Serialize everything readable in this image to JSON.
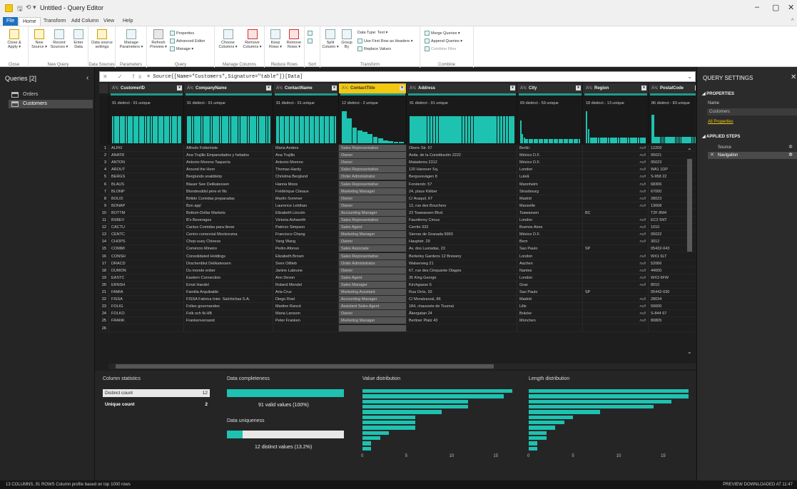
{
  "window": {
    "title": "Untitled - Query Editor",
    "minimize": "–",
    "maximize": "▢",
    "close": "✕",
    "help": "^"
  },
  "menu": {
    "tabs": [
      "File",
      "Home",
      "Transform",
      "Add Column",
      "View",
      "Help"
    ],
    "active": "Home"
  },
  "ribbon": {
    "groups": [
      {
        "label": "Close",
        "buttons": [
          "Close & Apply ▾"
        ]
      },
      {
        "label": "New Query",
        "buttons": [
          "New Source ▾",
          "Recent Sources ▾",
          "Enter Data"
        ]
      },
      {
        "label": "Data Sources",
        "buttons": [
          "Data source settings"
        ]
      },
      {
        "label": "Parameters",
        "buttons": [
          "Manage Parameters ▾"
        ]
      },
      {
        "label": "Query",
        "buttons": [
          "Refresh Preview ▾"
        ],
        "small": [
          "Properties",
          "Advanced Editor",
          "Manage ▾"
        ]
      },
      {
        "label": "Manage Columns",
        "buttons": [
          "Choose Columns ▾",
          "Remove Columns ▾"
        ]
      },
      {
        "label": "Reduce Rows",
        "buttons": [
          "Keep Rows ▾",
          "Remove Rows ▾"
        ]
      },
      {
        "label": "Sort",
        "buttons": []
      },
      {
        "label": "Transform",
        "buttons": [
          "Split Column ▾",
          "Group By"
        ],
        "small": [
          "Data Type: Text ▾",
          "Use First Row as Headers ▾",
          "Replace Values"
        ]
      },
      {
        "label": "Combine",
        "small": [
          "Merge Queries ▾",
          "Append Queries ▾",
          "Combine Files"
        ]
      }
    ]
  },
  "queries": {
    "title": "Queries [2]",
    "items": [
      "Orders",
      "Customers"
    ],
    "selected": "Customers"
  },
  "formula": {
    "fx": "✕ ✓ fx",
    "text": "= Source{[Name=\"Customers\",Signature=\"table\"]}[Data]"
  },
  "columns": [
    {
      "name": "CustomerID",
      "type": "A¹c",
      "distinct": "91 distinct - 91 unique"
    },
    {
      "name": "CompanyName",
      "type": "A¹c",
      "distinct": "91 distinct - 91 unique"
    },
    {
      "name": "ContactName",
      "type": "A¹c",
      "distinct": "91 distinct - 91 unique"
    },
    {
      "name": "ContactTitle",
      "type": "A¹c",
      "distinct": "12 distinct - 2 unique"
    },
    {
      "name": "Address",
      "type": "A¹c",
      "distinct": "91 distinct - 91 unique"
    },
    {
      "name": "City",
      "type": "A¹c",
      "distinct": "69 distinct - 59 unique"
    },
    {
      "name": "Region",
      "type": "A¹c",
      "distinct": "18 distinct - 13 unique"
    },
    {
      "name": "PostalCode",
      "type": "A¹c",
      "distinct": "86 distinct - 83 unique"
    }
  ],
  "rows": [
    [
      "1",
      "ALFKI",
      "Alfreds Futterkiste",
      "Maria Anders",
      "Sales Representative",
      "Obere Str. 57",
      "Berlin",
      "null",
      "12209"
    ],
    [
      "2",
      "ANATR",
      "Ana Trujillo Emparedados y helados",
      "Ana Trujillo",
      "Owner",
      "Avda. de la Constitución 2222",
      "México D.F.",
      "null",
      "05021"
    ],
    [
      "3",
      "ANTON",
      "Antonio Moreno Taquería",
      "Antonio Moreno",
      "Owner",
      "Mataderos  2312",
      "México D.F.",
      "null",
      "05023"
    ],
    [
      "4",
      "AROUT",
      "Around the Horn",
      "Thomas Hardy",
      "Sales Representative",
      "120 Hanover Sq.",
      "London",
      "null",
      "WA1 1DP"
    ],
    [
      "5",
      "BERGS",
      "Berglunds snabbköp",
      "Christina Berglund",
      "Order Administrator",
      "Berguvsvägen  8",
      "Luleå",
      "null",
      "S-958 22"
    ],
    [
      "6",
      "BLAUS",
      "Blauer See Delikatessen",
      "Hanna Moos",
      "Sales Representative",
      "Forsterstr. 57",
      "Mannheim",
      "null",
      "68306"
    ],
    [
      "7",
      "BLONP",
      "Blondesddsl père et fils",
      "Frédérique Citeaux",
      "Marketing Manager",
      "24, place Kléber",
      "Strasbourg",
      "null",
      "67000"
    ],
    [
      "8",
      "BOLID",
      "Bólido Comidas preparadas",
      "Martín Sommer",
      "Owner",
      "C/ Araquil, 67",
      "Madrid",
      "null",
      "28023"
    ],
    [
      "9",
      "BONAP",
      "Bon app'",
      "Laurence Lebihan",
      "Owner",
      "12, rue des Bouchers",
      "Marseille",
      "null",
      "13008"
    ],
    [
      "10",
      "BOTTM",
      "Bottom-Dollar Markets",
      "Elizabeth Lincoln",
      "Accounting Manager",
      "23 Tsawassen Blvd.",
      "Tsawassen",
      "BC",
      "T2F 8M4"
    ],
    [
      "11",
      "BSBEV",
      "B's Beverages",
      "Victoria Ashworth",
      "Sales Representative",
      "Fauntleroy Circus",
      "London",
      "null",
      "EC2 5NT"
    ],
    [
      "12",
      "CACTU",
      "Cactus Comidas para llevar",
      "Patricio Simpson",
      "Sales Agent",
      "Cerrito 333",
      "Buenos Aires",
      "null",
      "1010"
    ],
    [
      "13",
      "CENTC",
      "Centro comercial Moctezuma",
      "Francisco Chang",
      "Marketing Manager",
      "Sierras de Granada 9993",
      "México D.F.",
      "null",
      "05022"
    ],
    [
      "14",
      "CHOPS",
      "Chop-suey Chinese",
      "Yang Wang",
      "Owner",
      "Hauptstr. 29",
      "Bern",
      "null",
      "3012"
    ],
    [
      "15",
      "COMMI",
      "Comércio Mineiro",
      "Pedro Afonso",
      "Sales Associate",
      "Av. dos Lusíadas, 23",
      "Sao Paulo",
      "SP",
      "05432-043"
    ],
    [
      "16",
      "CONSH",
      "Consolidated Holdings",
      "Elizabeth Brown",
      "Sales Representative",
      "Berkeley Gardens 12  Brewery",
      "London",
      "null",
      "WX1 6LT"
    ],
    [
      "17",
      "DRACD",
      "Drachenblut Delikatessen",
      "Sven Ottlieb",
      "Order Administrator",
      "Walserweg 21",
      "Aachen",
      "null",
      "52066"
    ],
    [
      "18",
      "DUMON",
      "Du monde entier",
      "Janine Labrune",
      "Owner",
      "67, rue des Cinquante Otages",
      "Nantes",
      "null",
      "44000"
    ],
    [
      "19",
      "EASTC",
      "Eastern Connection",
      "Ann Devon",
      "Sales Agent",
      "35 King George",
      "London",
      "null",
      "WX3 6FW"
    ],
    [
      "20",
      "ERNSH",
      "Ernst Handel",
      "Roland Mendel",
      "Sales Manager",
      "Kirchgasse 6",
      "Graz",
      "null",
      "8010"
    ],
    [
      "21",
      "FAMIA",
      "Familia Arquibaldo",
      "Aria Cruz",
      "Marketing Assistant",
      "Rua Orós, 92",
      "Sao Paulo",
      "SP",
      "05442-030"
    ],
    [
      "22",
      "FISSA",
      "FISSA Fabrica Inter. Salchichas S.A.",
      "Diego Roel",
      "Accounting Manager",
      "C/ Moralzarzal, 86",
      "Madrid",
      "null",
      "28034"
    ],
    [
      "23",
      "FOLIG",
      "Folies gourmandes",
      "Martine Rancé",
      "Assistant Sales Agent",
      "184, chaussée de Tournai",
      "Lille",
      "null",
      "59000"
    ],
    [
      "24",
      "FOLKO",
      "Folk och fä HB",
      "Maria Larsson",
      "Owner",
      "Åkergatan 24",
      "Bräcke",
      "null",
      "S-844 67"
    ],
    [
      "25",
      "FRANK",
      "Frankenversand",
      "Peter Franken",
      "Marketing Manager",
      "Berliner Platz 43",
      "München",
      "null",
      "80805"
    ],
    [
      "26",
      "",
      "",
      "",
      "",
      "",
      "",
      "",
      ""
    ]
  ],
  "stats": {
    "column_statistics": "Column statistics",
    "distinct_label": "Distinct count",
    "distinct_value": "12",
    "unique_label": "Unique count",
    "unique_value": "2",
    "completeness_title": "Data completeness",
    "completeness_text": "91 valid values (100%)",
    "completeness_pct": 100,
    "uniqueness_title": "Data uniqueness",
    "uniqueness_text": "12 distinct values (13.2%)",
    "uniqueness_pct": 13.2,
    "value_dist_title": "Value distribution",
    "length_dist_title": "Length distribution",
    "value_dist": [
      17,
      16,
      12,
      12,
      9,
      6,
      6,
      6,
      3,
      2,
      1,
      1
    ],
    "length_dist": [
      18,
      18,
      16,
      14,
      8,
      5,
      4,
      3,
      2,
      2,
      1,
      1
    ],
    "axis_ticks": [
      "0",
      "5",
      "10",
      "15"
    ]
  },
  "settings": {
    "title": "QUERY SETTINGS",
    "properties": "◢ PROPERTIES",
    "name_label": "Name",
    "name_value": "Customers",
    "all_properties": "All Properties",
    "applied_steps": "◢ APPLIED STEPS",
    "steps": [
      "Source",
      "Navigation"
    ],
    "selected_step": "Navigation"
  },
  "status": {
    "left": "13 COLUMNS, 91 ROWS     Column profile based on top 1000 rows",
    "right": "PREVIEW DOWNLOADED AT 11:47"
  },
  "colors": {
    "accent": "#f2c811",
    "teal": "#1ec2b0",
    "file_tab": "#1e6fc1"
  }
}
